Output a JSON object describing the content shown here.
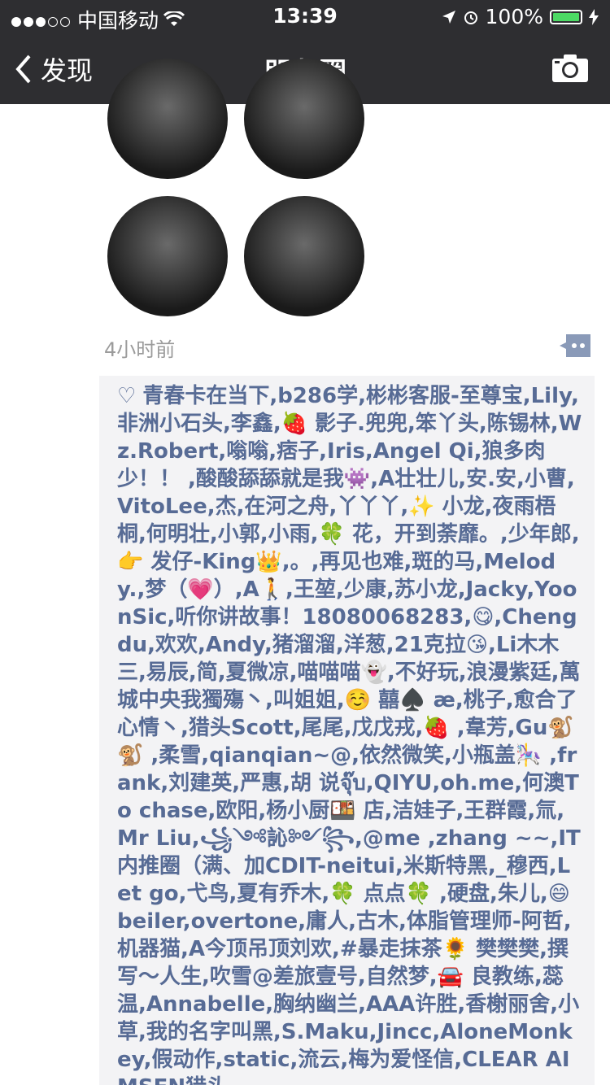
{
  "status": {
    "carrier": "中国移动",
    "time": "13:39",
    "battery": "100%",
    "battery_level": 1.0
  },
  "nav": {
    "back_label": "发现",
    "title": "朋友圈",
    "camera_icon": "camera-icon"
  },
  "post": {
    "time_ago": "4小时前"
  },
  "likes": {
    "text": "青春卡在当下,b286学,彬彬客服-至尊宝,Lily,非洲小石头,李鑫,🍓 影子.兜兜,笨丫头,陈锡林,Wz.Robert,嗡嗡,痞子,Iris,Angel Qi,狼多肉少！！ ,酸酸舔舔就是我👾,A壮壮儿,安.安,小曹,VitoLee,杰,在河之舟,丫丫丫,✨ 小龙,夜雨梧桐,何明壮,小郭,小雨,🍀 花，开到荼靡。,少年郎,👉 发仔-King👑,。,再见也难,斑的马,Melody.,梦（💗）,A🚶,王堃,少康,苏小龙,Jacky,YoonSic,听你讲故事！18080068283,😋,Chengdu,欢欢,Andy,猪溜溜,洋葱,21克拉😘,Li木木三,易辰,简,夏微凉,喵喵喵👻,不好玩,浪漫紫廷,萬城中央我獨殤丶,叫姐姐,☺️ 囍♠️ æ,桃子,愈合了心情丶,猎头Scott,尾尾,戊戊戎,🍓 ,韋芳,Gu🐒 🐒 ,柔雪,qianqian~@,依然微笑,小瓶盖🎠 ,frank,刘建英,严惠,胡 说จุ๊บ,QIYU,oh.me,何澳To chase,欧阳,杨小厨🍱 店,洁娃子,王群霞,氚,Mr Liu,꧁༺訫༻꧂,@me ,zhang ~~,IT内推圈（满、加CDIT-neitui,米斯特黑,_穆西,Let go,弋鸟,夏有乔木,🍀 点点🍀 ,硬盘,朱儿,😄 beiler,overtone,庸人,古木,体脂管理师-阿哲,机器猫,A今顶吊顶刘欢,#暴走抹茶🌻 樊樊樊,撰写～人生,吹雪@差旅壹号,自然梦,🚘 良教练,蕊温,Annabelle,胸纳幽兰,AAA许胜,香榭丽舍,小草,我的名字叫黑,S.Maku,Jincc,AloneMonkey,假动作,static,流云,梅为爱怪信,CLEAR AIMSEN猎头"
  },
  "colors": {
    "bar": "#2e2e31",
    "link": "#576b95",
    "likes_bg": "#f3f3f5",
    "meta": "#9b9b9b"
  }
}
